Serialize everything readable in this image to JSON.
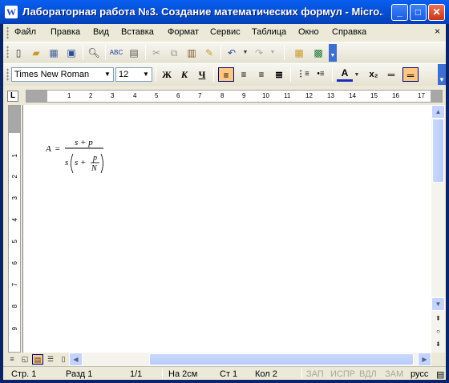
{
  "window": {
    "title": "Лабораторная работа №3. Создание математических формул - Micro...",
    "app_icon": "word-icon"
  },
  "menu": {
    "items": [
      "Файл",
      "Правка",
      "Вид",
      "Вставка",
      "Формат",
      "Сервис",
      "Таблица",
      "Окно",
      "Справка"
    ],
    "close_glyph": "×"
  },
  "toolbar_standard": {
    "icons": [
      "new-document-icon",
      "open-icon",
      "permission-icon",
      "save-icon",
      "print-preview-icon",
      "spelling-icon",
      "research-icon",
      "cut-icon",
      "copy-icon",
      "paste-icon",
      "format-painter-icon",
      "undo-icon",
      "redo-icon",
      "insert-table-icon",
      "excel-icon"
    ]
  },
  "toolbar_format": {
    "font": "Times New Roman",
    "size": "12",
    "bold": "Ж",
    "italic": "К",
    "underline": "Ч",
    "font_color_letter": "A",
    "subscript": "x₂",
    "active_color": "#ffc880"
  },
  "ruler": {
    "corner": "L",
    "h_numbers": [
      "1",
      "2",
      "3",
      "4",
      "5",
      "6",
      "7",
      "8",
      "9",
      "10",
      "11",
      "12",
      "13",
      "14",
      "15",
      "16",
      "17"
    ],
    "v_numbers": [
      "1",
      "2",
      "3",
      "4",
      "5",
      "6",
      "7",
      "8",
      "9"
    ]
  },
  "formula": {
    "lhs": "A",
    "eq": "=",
    "numerator": "s + p",
    "den_s": "s",
    "inner_s": "s +",
    "inner_num": "p",
    "inner_den": "N"
  },
  "status": {
    "page": "Стр. 1",
    "section": "Разд 1",
    "pages": "1/1",
    "at": "На 2см",
    "line": "Ст 1",
    "col": "Кол 2",
    "rec": "ЗАП",
    "trk": "ИСПР",
    "ext": "ВДЛ",
    "ovr": "ЗАМ",
    "lang": "русс"
  }
}
